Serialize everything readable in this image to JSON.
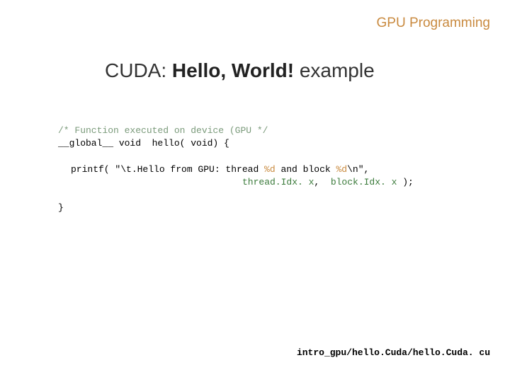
{
  "header": {
    "text": "GPU Programming"
  },
  "title": {
    "part1": "CUDA:  ",
    "bold": "Hello, World!",
    "part2": "  example"
  },
  "code": {
    "line1_comment": "/* Function executed on device (GPU */",
    "line2": "__global__ void  hello( void) {",
    "line3_a": "printf( \"\\t.Hello from GPU: thread ",
    "line3_fmt1": "%d",
    "line3_b": " and block ",
    "line3_fmt2": "%d",
    "line3_c": "\\n\",",
    "line4_arg1": "thread.Idx. x",
    "line4_sep": ",  ",
    "line4_arg2": "block.Idx. x",
    "line4_end": " );",
    "line5": "}"
  },
  "footer": {
    "path": "intro_gpu/hello.Cuda/hello.Cuda. cu"
  }
}
